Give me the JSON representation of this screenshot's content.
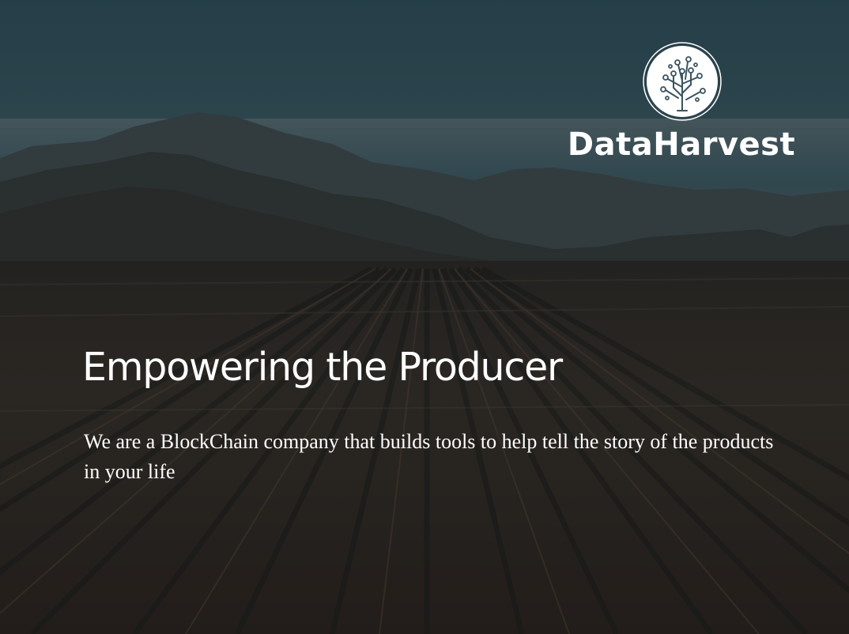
{
  "brand": {
    "name": "DataHarvest",
    "logo_icon": "circuit-tree-icon"
  },
  "hero": {
    "headline": "Empowering the Producer",
    "description": "We are a BlockChain company that builds tools to help tell the story of the products in your life"
  },
  "colors": {
    "text": "#ffffff",
    "sky": "#2b4a56",
    "soil": "#3a2c22"
  }
}
